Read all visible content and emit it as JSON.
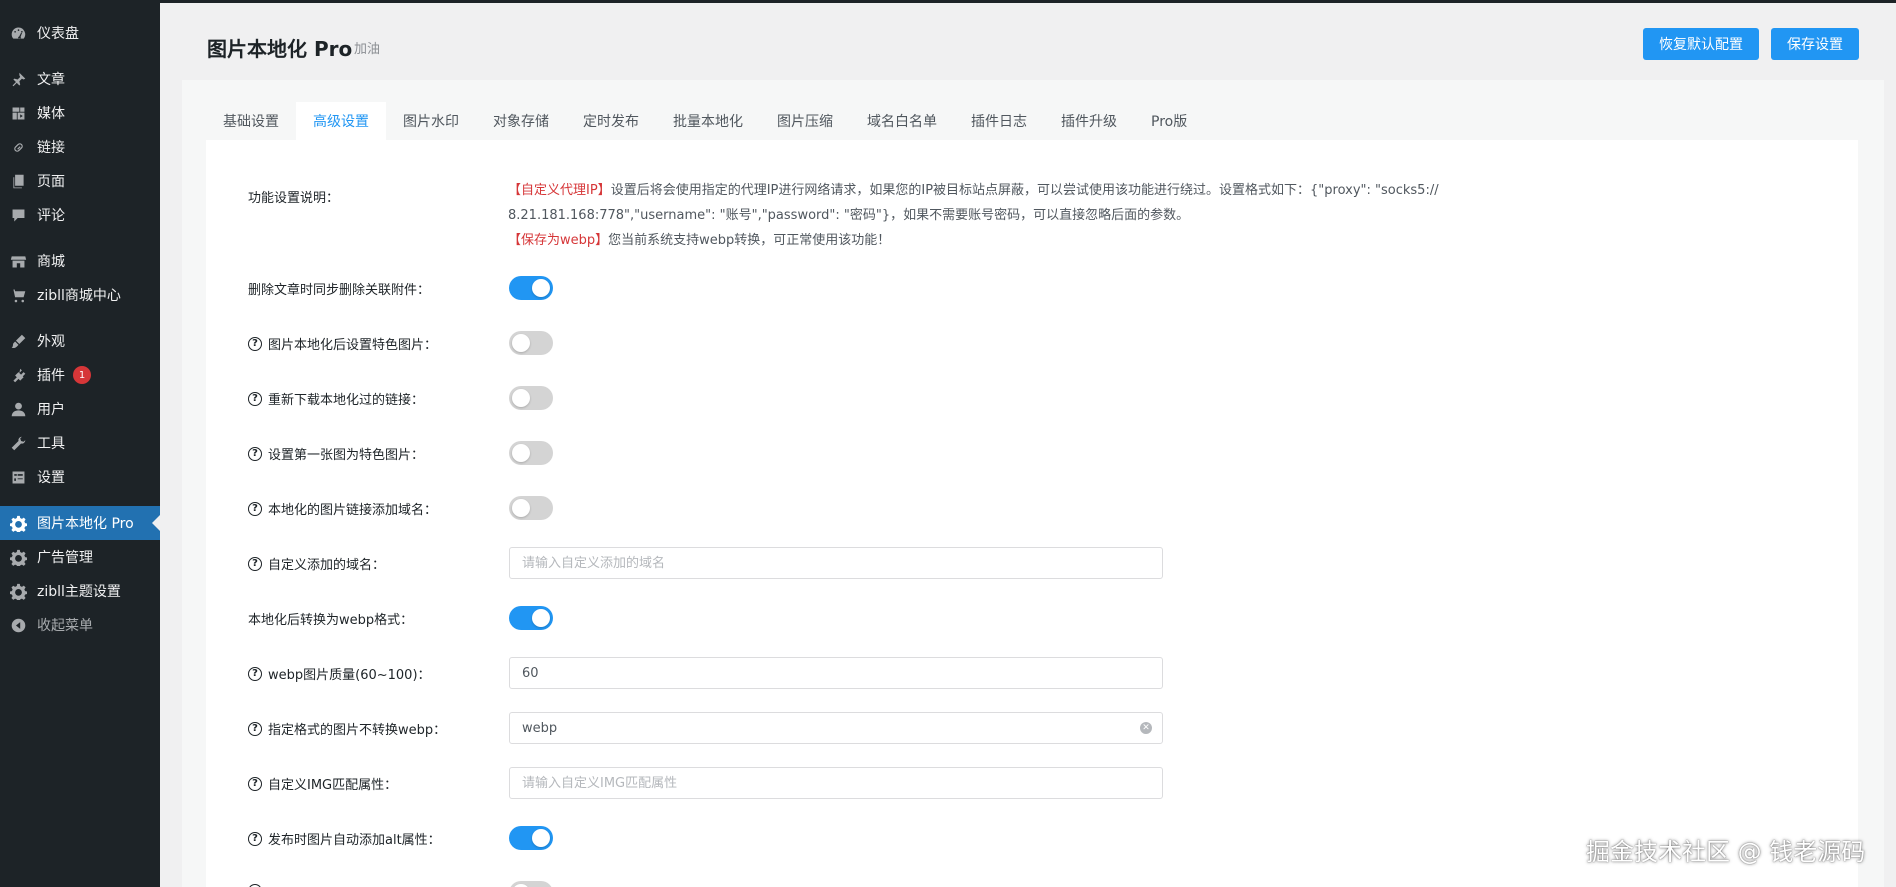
{
  "sidebar": {
    "items": [
      {
        "label": "仪表盘",
        "icon": "dashboard-icon"
      },
      {
        "label": "文章",
        "icon": "pin-icon"
      },
      {
        "label": "媒体",
        "icon": "media-icon"
      },
      {
        "label": "链接",
        "icon": "link-icon"
      },
      {
        "label": "页面",
        "icon": "page-icon"
      },
      {
        "label": "评论",
        "icon": "comment-icon"
      },
      {
        "label": "商城",
        "icon": "store-icon"
      },
      {
        "label": "zibll商城中心",
        "icon": "cart-icon"
      },
      {
        "label": "外观",
        "icon": "brush-icon"
      },
      {
        "label": "插件",
        "icon": "plugin-icon",
        "badge": "1"
      },
      {
        "label": "用户",
        "icon": "user-icon"
      },
      {
        "label": "工具",
        "icon": "wrench-icon"
      },
      {
        "label": "设置",
        "icon": "settings-icon"
      },
      {
        "label": "图片本地化 Pro",
        "icon": "gear-icon"
      },
      {
        "label": "广告管理",
        "icon": "gear-icon"
      },
      {
        "label": "zibll主题设置",
        "icon": "gear-icon"
      },
      {
        "label": "收起菜单",
        "icon": "collapse-icon"
      }
    ]
  },
  "header": {
    "title": "图片本地化 Pro",
    "subtitle": "加油",
    "restore_label": "恢复默认配置",
    "save_label": "保存设置"
  },
  "tabs": [
    "基础设置",
    "高级设置",
    "图片水印",
    "对象存储",
    "定时发布",
    "批量本地化",
    "图片压缩",
    "域名白名单",
    "插件日志",
    "插件升级",
    "Pro版"
  ],
  "active_tab": "高级设置",
  "description": {
    "label": "功能设置说明：",
    "proxy_tag": "【自定义代理IP】",
    "proxy_text_1": "设置后将会使用指定的代理IP进行网络请求，如果您的IP被目标站点屏蔽，可以尝试使用该功能进行绕过。设置格式如下：{\"proxy\": \"socks5://",
    "proxy_text_2": "8.21.181.168:778\",\"username\": \"账号\",\"password\": \"密码\"}，如果不需要账号密码，可以直接忽略后面的参数。",
    "webp_tag": "【保存为webp】",
    "webp_text": "您当前系统支持webp转换，可正常使用该功能！"
  },
  "settings": [
    {
      "label": "删除文章时同步删除关联附件：",
      "help": false,
      "type": "toggle",
      "on": true
    },
    {
      "label": "图片本地化后设置特色图片：",
      "help": true,
      "type": "toggle",
      "on": false
    },
    {
      "label": "重新下载本地化过的链接：",
      "help": true,
      "type": "toggle",
      "on": false
    },
    {
      "label": "设置第一张图为特色图片：",
      "help": true,
      "type": "toggle",
      "on": false
    },
    {
      "label": "本地化的图片链接添加域名：",
      "help": true,
      "type": "toggle",
      "on": false
    },
    {
      "label": "自定义添加的域名：",
      "help": true,
      "type": "input",
      "value": "",
      "placeholder": "请输入自定义添加的域名"
    },
    {
      "label": "本地化后转换为webp格式：",
      "help": false,
      "type": "toggle",
      "on": true
    },
    {
      "label": "webp图片质量(60~100)：",
      "help": true,
      "type": "input",
      "value": "60",
      "placeholder": ""
    },
    {
      "label": "指定格式的图片不转换webp：",
      "help": true,
      "type": "input",
      "value": "webp",
      "placeholder": "",
      "clearable": true
    },
    {
      "label": "自定义IMG匹配属性：",
      "help": true,
      "type": "input",
      "value": "",
      "placeholder": "请输入自定义IMG匹配属性"
    },
    {
      "label": "发布时图片自动添加alt属性：",
      "help": true,
      "type": "toggle",
      "on": true
    }
  ],
  "watermark": "掘金技术社区 @ 钱老源码",
  "colors": {
    "accent": "#2196f3",
    "sidebar": "#1d2327",
    "active": "#2271b1",
    "red": "#d63638"
  }
}
